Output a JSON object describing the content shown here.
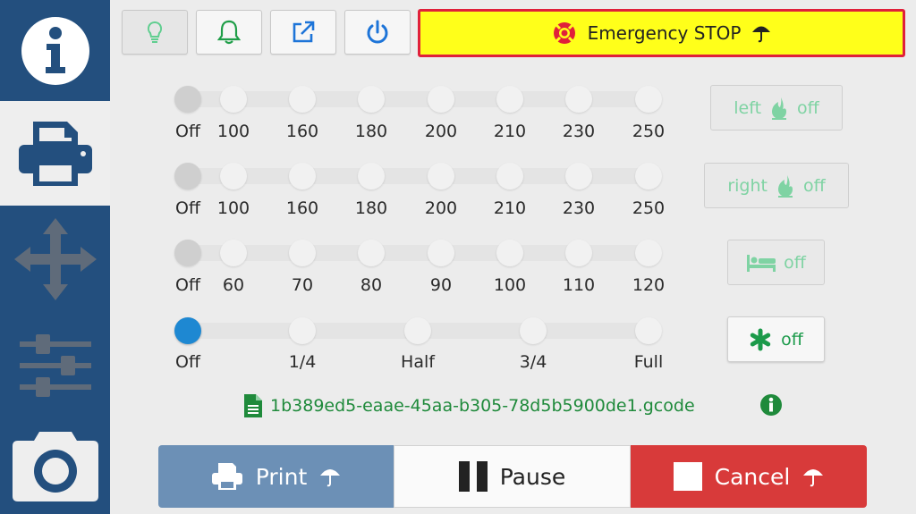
{
  "sidebar": {
    "tabs": [
      {
        "name": "info",
        "icon": "info-icon"
      },
      {
        "name": "print",
        "icon": "printer-icon",
        "active": true
      },
      {
        "name": "move",
        "icon": "move-arrows-icon"
      },
      {
        "name": "settings",
        "icon": "sliders-icon"
      },
      {
        "name": "camera",
        "icon": "camera-icon"
      }
    ]
  },
  "toolbar": {
    "buttons": [
      {
        "name": "light",
        "icon": "lightbulb-icon",
        "color": "#5fce8f"
      },
      {
        "name": "notifications",
        "icon": "bell-icon",
        "color": "#1f9e48"
      },
      {
        "name": "external",
        "icon": "external-link-icon",
        "color": "#1d74d8"
      },
      {
        "name": "power",
        "icon": "power-icon",
        "color": "#1d74d8"
      }
    ],
    "emergency_label": "Emergency STOP"
  },
  "sliders": [
    {
      "name": "left-extruder",
      "ticks": [
        "Off",
        "100",
        "160",
        "180",
        "200",
        "210",
        "230",
        "250"
      ],
      "selected": 0
    },
    {
      "name": "right-extruder",
      "ticks": [
        "Off",
        "100",
        "160",
        "180",
        "200",
        "210",
        "230",
        "250"
      ],
      "selected": 0
    },
    {
      "name": "bed",
      "ticks": [
        "Off",
        "60",
        "70",
        "80",
        "90",
        "100",
        "110",
        "120"
      ],
      "selected": 0
    },
    {
      "name": "fan",
      "ticks": [
        "Off",
        "1/4",
        "Half",
        "3/4",
        "Full"
      ],
      "selected": 0
    }
  ],
  "toggles": {
    "left": {
      "prefix": "left",
      "state": "off"
    },
    "right": {
      "prefix": "right",
      "state": "off"
    },
    "bed": {
      "state": "off"
    },
    "fan": {
      "state": "off"
    }
  },
  "file": {
    "name": "1b389ed5-eaae-45aa-b305-78d5b5900de1.gcode"
  },
  "actions": {
    "print": "Print",
    "pause": "Pause",
    "cancel": "Cancel"
  },
  "colors": {
    "sidebar": "#234f7e",
    "estop_bg": "#ffff1a",
    "estop_border": "#e0203a",
    "green": "#1f9e48",
    "slider_selected": "#1e88d2"
  }
}
